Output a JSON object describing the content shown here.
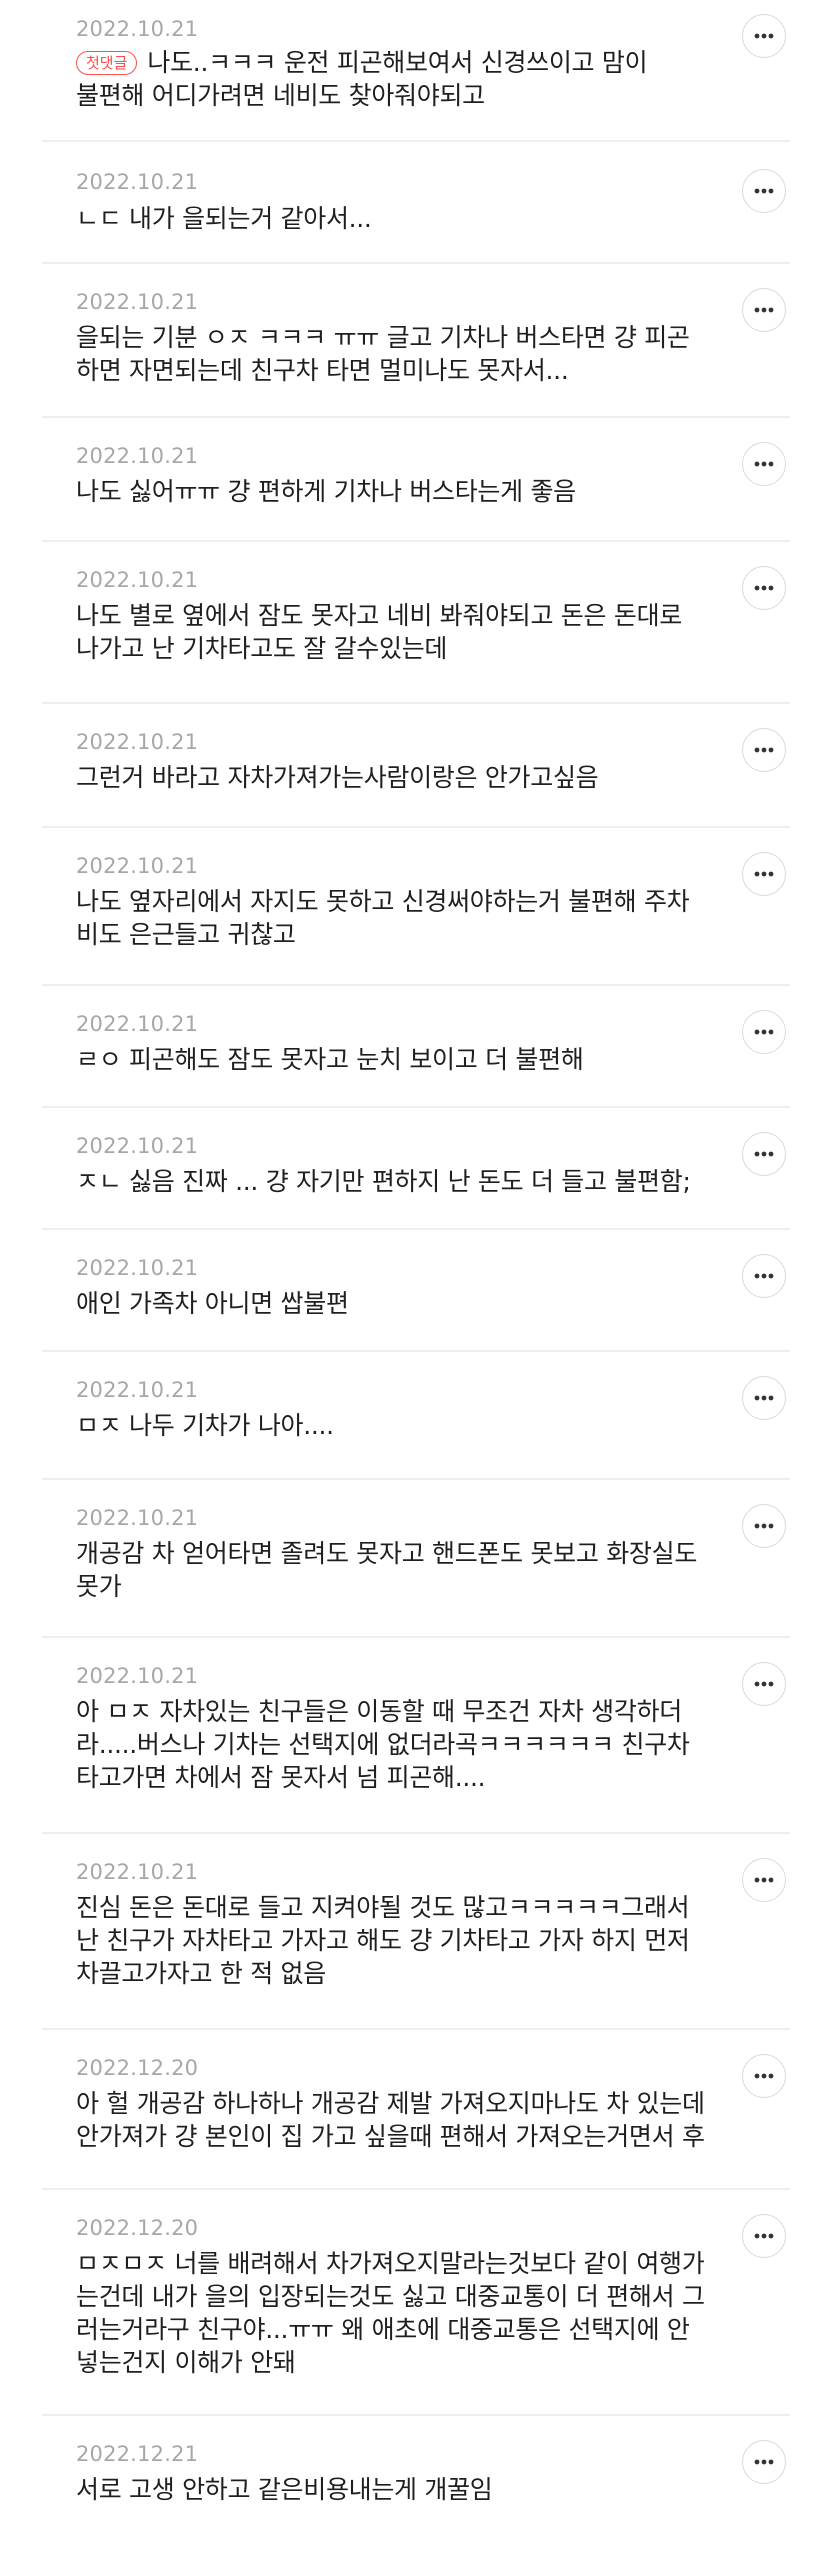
{
  "more_icon": "more-horizontal-icon",
  "colors": {
    "date": "#a7a7a7",
    "text": "#1f1f1f",
    "divider": "#eeeeee",
    "badge": "#ff4d4d"
  },
  "comments": [
    {
      "date": "2022.10.21",
      "badge": "첫댓글",
      "text": "나도..ㅋㅋㅋ 운전 피곤해보여서 신경쓰이고 맘이\n불편해 어디가려면 네비도 찾아줘야되고"
    },
    {
      "date": "2022.10.21",
      "text": "ㄴㄷ 내가 을되는거 같아서..."
    },
    {
      "date": "2022.10.21",
      "text": "을되는 기분 ㅇㅈ ㅋㅋㅋ ㅠㅠ 글고 기차나 버스타면 걍 피곤\n하면 자면되는데 친구차 타면 멀미나도 못자서..."
    },
    {
      "date": "2022.10.21",
      "text": "나도 싫어ㅠㅠ 걍 편하게 기차나 버스타는게 좋음"
    },
    {
      "date": "2022.10.21",
      "text": "나도 별로 옆에서 잠도 못자고 네비 봐줘야되고 돈은 돈대로\n나가고 난 기차타고도 잘 갈수있는데"
    },
    {
      "date": "2022.10.21",
      "text": "그런거 바라고 자차가져가는사람이랑은 안가고싶음"
    },
    {
      "date": "2022.10.21",
      "text": "나도 옆자리에서 자지도 못하고 신경써야하는거 불편해 주차\n비도 은근들고 귀찮고"
    },
    {
      "date": "2022.10.21",
      "text": "ㄹㅇ 피곤해도 잠도 못자고 눈치 보이고 더 불편해"
    },
    {
      "date": "2022.10.21",
      "text": "ㅈㄴ 싫음 진짜 ... 걍 자기만 편하지 난 돈도 더 들고 불편함;"
    },
    {
      "date": "2022.10.21",
      "text": "애인 가족차 아니면 쌉불편"
    },
    {
      "date": "2022.10.21",
      "text": "ㅁㅈ 나두 기차가 나아...."
    },
    {
      "date": "2022.10.21",
      "text": "개공감 차 얻어타면 졸려도 못자고 핸드폰도 못보고 화장실도\n못가"
    },
    {
      "date": "2022.10.21",
      "text": "아 ㅁㅈ 자차있는 친구들은 이동할 때 무조건 자차 생각하더\n라.....버스나 기차는 선택지에 없더라곡ㅋㅋㅋㅋㅋㅋ 친구차\n타고가면 차에서 잠 못자서 넘 피곤해...."
    },
    {
      "date": "2022.10.21",
      "text": "진심 돈은 돈대로 들고 지켜야될 것도 많고ㅋㅋㅋㅋㅋ그래서\n난 친구가 자차타고 가자고 해도 걍 기차타고 가자 하지 먼저\n차끌고가자고 한 적 없음"
    },
    {
      "date": "2022.12.20",
      "text": "아 헐 개공감 하나하나 개공감 제발 가져오지마나도 차 있는데\n안가져가 걍 본인이 집 가고 싶을때 편해서 가져오는거면서 후"
    },
    {
      "date": "2022.12.20",
      "text": "ㅁㅈㅁㅈ 너를 배려해서 차가져오지말라는것보다 같이 여행가\n는건데 내가 을의 입장되는것도 싫고 대중교통이 더 편해서 그\n러는거라구 친구야...ㅠㅠ 왜 애초에 대중교통은 선택지에 안\n넣는건지 이해가 안돼"
    },
    {
      "date": "2022.12.21",
      "text": "서로 고생 안하고 같은비용내는게 개꿀임"
    }
  ]
}
